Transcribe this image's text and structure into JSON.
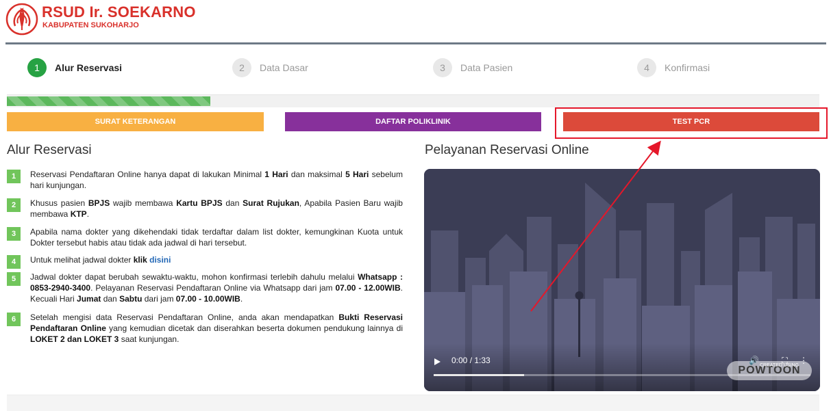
{
  "header": {
    "brand_name": "RSUD Ir. SOEKARNO",
    "brand_sub": "KABUPATEN SUKOHARJO",
    "logo_icon": "hospital-logo-icon",
    "brand_color": "#d9312b"
  },
  "steps": [
    {
      "num": "1",
      "label": "Alur Reservasi",
      "active": true
    },
    {
      "num": "2",
      "label": "Data Dasar",
      "active": false
    },
    {
      "num": "3",
      "label": "Data Pasien",
      "active": false
    },
    {
      "num": "4",
      "label": "Konfirmasi",
      "active": false
    }
  ],
  "progress": {
    "value_percent": 25,
    "color": "#5cb85c"
  },
  "buttons": {
    "surat": "SURAT KETERANGAN",
    "poliklinik": "DAFTAR POLIKLINIK",
    "pcr": "TEST PCR"
  },
  "alur": {
    "title": "Alur Reservasi",
    "items": [
      {
        "num": "1"
      },
      {
        "num": "2"
      },
      {
        "num": "3"
      },
      {
        "num": "4"
      },
      {
        "num": "5"
      },
      {
        "num": "6"
      }
    ],
    "t1": {
      "a": "Reservasi Pendaftaran Online hanya dapat di lakukan Minimal ",
      "b1": "1 Hari",
      "c": " dan maksimal ",
      "b2": "5 Hari",
      "d": " sebelum hari kunjungan."
    },
    "t2": {
      "a": "Khusus pasien ",
      "b1": "BPJS",
      "c": " wajib membawa ",
      "b2": "Kartu BPJS",
      "d": " dan ",
      "b3": "Surat Rujukan",
      "e": ", Apabila Pasien Baru wajib membawa ",
      "b4": "KTP",
      "f": "."
    },
    "t3": {
      "a": "Apabila nama dokter yang dikehendaki tidak terdaftar dalam list dokter, kemungkinan Kuota untuk Dokter tersebut habis atau tidak ada jadwal di hari tersebut."
    },
    "t4": {
      "a": "Untuk melihat jadwal dokter ",
      "b1": "klik",
      "link": "disini"
    },
    "t5": {
      "a": "Jadwal dokter dapat berubah sewaktu-waktu, mohon konfirmasi terlebih dahulu melalui ",
      "b1": "Whatsapp : 0853-2940-3400",
      "c": ". Pelayanan Reservasi Pendaftaran Online via Whatsapp dari jam ",
      "b2": "07.00 - 12.00WIB",
      "d": ". Kecuali Hari ",
      "b3": "Jumat",
      "e": " dan ",
      "b4": "Sabtu",
      "f": " dari jam ",
      "b5": "07.00 - 10.00WIB",
      "g": "."
    },
    "t6": {
      "a": "Setelah mengisi data Reservasi Pendaftaran Online, anda akan mendapatkan ",
      "b1": "Bukti Reservasi Pendaftaran Online",
      "c": " yang kemudian dicetak dan diserahkan beserta dokumen pendukung lainnya di ",
      "b2": "LOKET 2 dan LOKET 3",
      "d": " saat kunjungan."
    }
  },
  "pelayanan": {
    "title": "Pelayanan Reservasi Online",
    "video": {
      "time": "0:00 / 1:33",
      "played_fraction": 0.24,
      "watermark": "POWTOON",
      "watermark_tag": "CREATED USING"
    }
  },
  "colors": {
    "active_step": "#27a243",
    "surat": "#f8b042",
    "poliklinik": "#87309b",
    "pcr": "#dc4a3a",
    "highlight": "#e5172a",
    "list_badge": "#71c55b"
  }
}
